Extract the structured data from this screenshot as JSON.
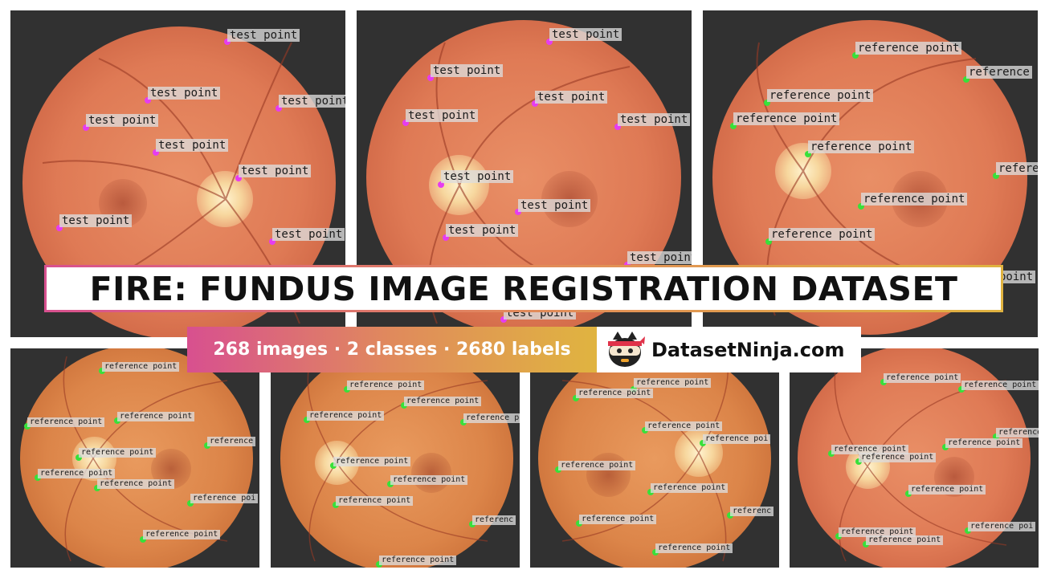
{
  "title": "FIRE: FUNDUS IMAGE REGISTRATION DATASET",
  "stats": "268 images · 2 classes · 2680 labels",
  "brand": "DatasetNinja.com",
  "brand_icon": "ninja-logo-icon",
  "colors": {
    "test_point": "#e63cf0",
    "reference_point": "#38e03a",
    "gradient": [
      "#d8508f",
      "#e28a5a",
      "#e0b340"
    ]
  },
  "tiles": [
    {
      "labels": [
        "test point",
        "test point",
        "test point",
        "test point",
        "test point",
        "test point",
        "test point",
        "test point"
      ]
    },
    {
      "labels": [
        "test point",
        "test point",
        "test point",
        "test point",
        "test point",
        "test point",
        "test point",
        "test point",
        "test point",
        "test point"
      ]
    },
    {
      "labels": [
        "reference point",
        "reference",
        "reference point",
        "reference point",
        "reference point",
        "refere",
        "reference point",
        "reference point",
        "point"
      ]
    },
    {
      "labels": [
        "reference point",
        "reference point",
        "reference point",
        "reference point",
        "reference",
        "reference point",
        "reference point",
        "reference poi",
        "reference point"
      ]
    },
    {
      "labels": [
        "reference point",
        "reference point",
        "reference point",
        "reference poi",
        "reference point",
        "reference point",
        "reference point",
        "referenc",
        "reference point"
      ]
    },
    {
      "labels": [
        "reference point",
        "reference point",
        "reference point",
        "reference poi",
        "reference point",
        "reference point",
        "referenc",
        "reference point",
        "reference point"
      ]
    },
    {
      "labels": [
        "reference point",
        "reference point",
        "reference",
        "reference point",
        "reference point",
        "reference point",
        "reference point",
        "reference poi",
        "reference point",
        "reference point"
      ]
    }
  ]
}
